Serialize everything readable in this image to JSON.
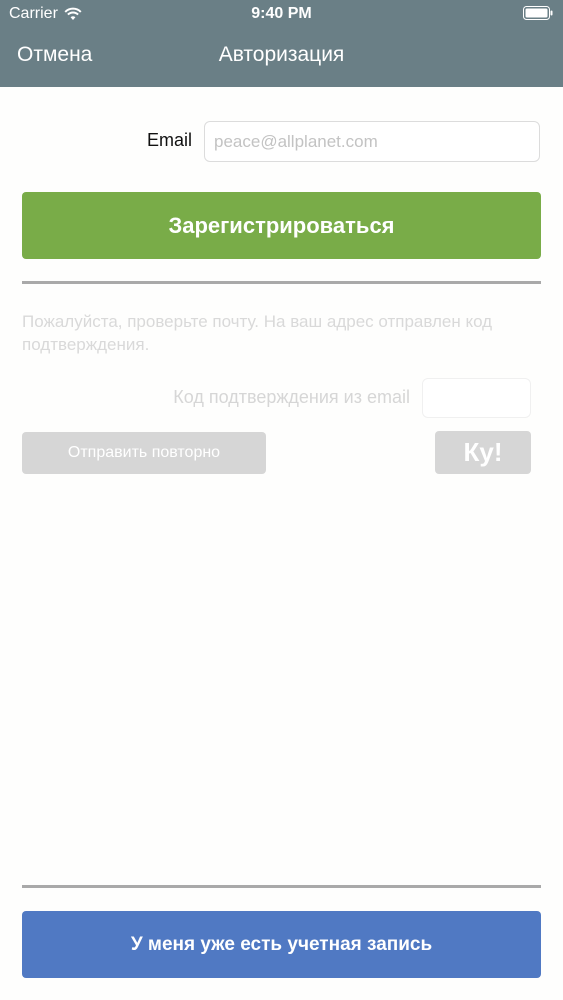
{
  "status_bar": {
    "carrier": "Carrier",
    "time": "9:40 PM"
  },
  "nav": {
    "cancel_label": "Отмена",
    "title": "Авторизация"
  },
  "form": {
    "email_label": "Email",
    "email_value": "",
    "email_placeholder": "peace@allplanet.com",
    "register_label": "Зарегистрироваться",
    "info_text": "Пожалуйста, проверьте почту. На ваш адрес отправлен код подтверждения.",
    "code_label": "Код подтверждения из email",
    "code_value": "",
    "resend_label": "Отправить повторно",
    "ku_label": "Ку!"
  },
  "footer": {
    "have_account_label": "У меня уже есть учетная запись"
  },
  "colors": {
    "nav_bar": "#6a7f86",
    "register_button": "#79ac48",
    "account_button": "#5079c3",
    "disabled_button": "#d6d6d6"
  },
  "icons": [
    "wifi-icon",
    "battery-icon"
  ]
}
